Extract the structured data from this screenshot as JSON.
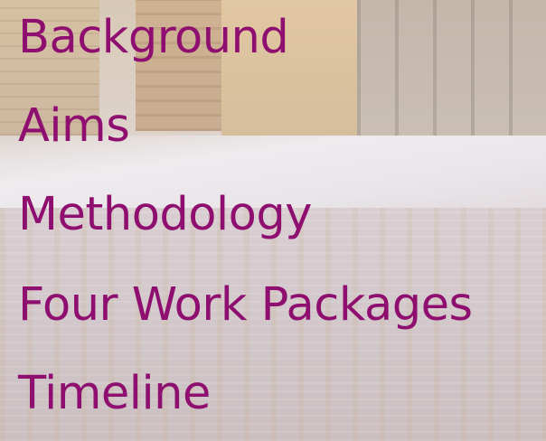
{
  "slide": {
    "items": [
      "Background",
      "Aims",
      "Methodology",
      "Four Work Packages",
      "Timeline"
    ]
  }
}
